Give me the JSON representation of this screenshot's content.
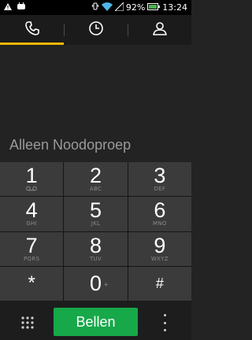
{
  "status_bar": {
    "battery": "92%",
    "time": "13:24",
    "icons": [
      "warning-icon",
      "android-icon",
      "vibrate-icon",
      "wifi-icon",
      "signal-icon",
      "battery-icon"
    ]
  },
  "tabs": [
    {
      "name": "dialer",
      "icon": "phone-icon",
      "active": true
    },
    {
      "name": "recent",
      "icon": "clock-icon",
      "active": false
    },
    {
      "name": "contacts",
      "icon": "person-icon",
      "active": false
    }
  ],
  "display": {
    "text": "Alleen Noodoproep"
  },
  "keypad": {
    "k1": {
      "digit": "1",
      "sub": "voicemail-icon"
    },
    "k2": {
      "digit": "2",
      "sub": "ABC"
    },
    "k3": {
      "digit": "3",
      "sub": "DEF"
    },
    "k4": {
      "digit": "4",
      "sub": "GHI"
    },
    "k5": {
      "digit": "5",
      "sub": "JKL"
    },
    "k6": {
      "digit": "6",
      "sub": "MNO"
    },
    "k7": {
      "digit": "7",
      "sub": "PQRS"
    },
    "k8": {
      "digit": "8",
      "sub": "TUV"
    },
    "k9": {
      "digit": "9",
      "sub": "WXYZ"
    },
    "star": {
      "digit": "*"
    },
    "k0": {
      "digit": "0",
      "alt": "+"
    },
    "hash": {
      "digit": "#"
    }
  },
  "bottom": {
    "call_label": "Bellen",
    "dialpad_icon": "dialpad-icon",
    "menu_icon": "overflow-menu-icon"
  },
  "colors": {
    "accent_tab": "#f2b705",
    "call_button": "#17a84a"
  }
}
